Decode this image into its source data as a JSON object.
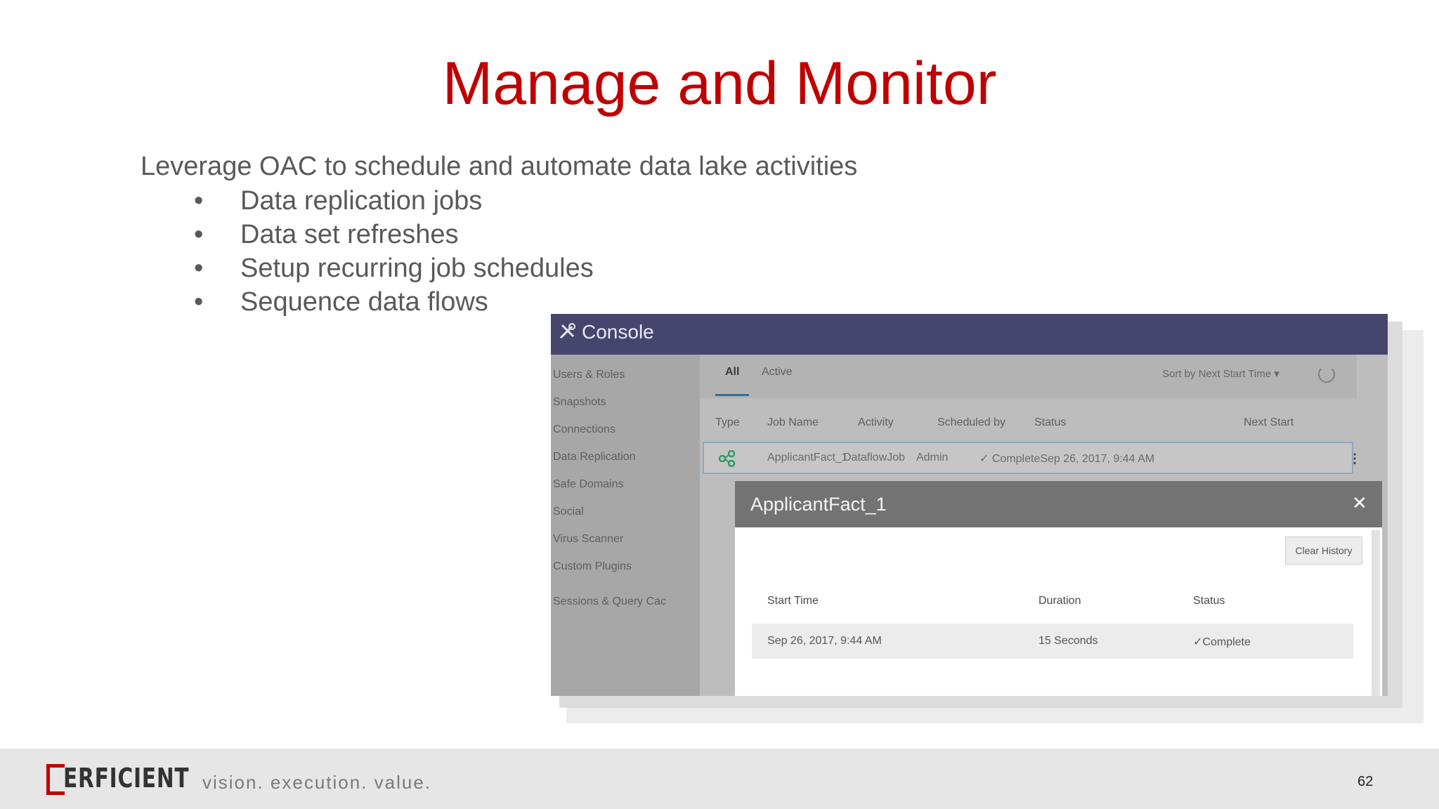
{
  "slide": {
    "title": "Manage and Monitor",
    "intro": "Leverage OAC to schedule and automate data lake activities",
    "bullets": [
      "Data replication jobs",
      "Data set refreshes",
      "Setup recurring job schedules",
      "Sequence data flows"
    ],
    "bullet_glyph": "•"
  },
  "console": {
    "title": "Console",
    "sidebar": [
      "Users & Roles",
      "Snapshots",
      "Connections",
      "Data Replication",
      "Safe Domains",
      "Social",
      "Virus Scanner",
      "Custom Plugins",
      "Sessions & Query Cac"
    ],
    "tabs": {
      "all": "All",
      "active": "Active"
    },
    "sort_label": "Sort by Next Start Time ▾",
    "columns": {
      "type": "Type",
      "job_name": "Job Name",
      "activity": "Activity",
      "scheduled_by": "Scheduled by",
      "status": "Status",
      "next_start": "Next Start"
    },
    "job_row": {
      "job_name": "ApplicantFact_1",
      "activity": "DataflowJob",
      "scheduled_by": "Admin",
      "status": "✓  CompleteSep 26, 2017, 9:44 AM"
    },
    "kebab": "⋮"
  },
  "dialog": {
    "title": "ApplicantFact_1",
    "close": "✕",
    "clear_history": "Clear History",
    "columns": {
      "start_time": "Start Time",
      "duration": "Duration",
      "status": "Status"
    },
    "row": {
      "start_time": "Sep 26, 2017, 9:44 AM",
      "duration": "15 Seconds",
      "status": "✓Complete"
    }
  },
  "footer": {
    "logo_text": "ERFICIENT",
    "tagline": "vision.  execution.  value.",
    "page_number": "62"
  },
  "colors": {
    "title": "#c00000",
    "console_bar": "#46456e",
    "brand_red": "#c00000",
    "check_green": "#2e9a3c"
  }
}
